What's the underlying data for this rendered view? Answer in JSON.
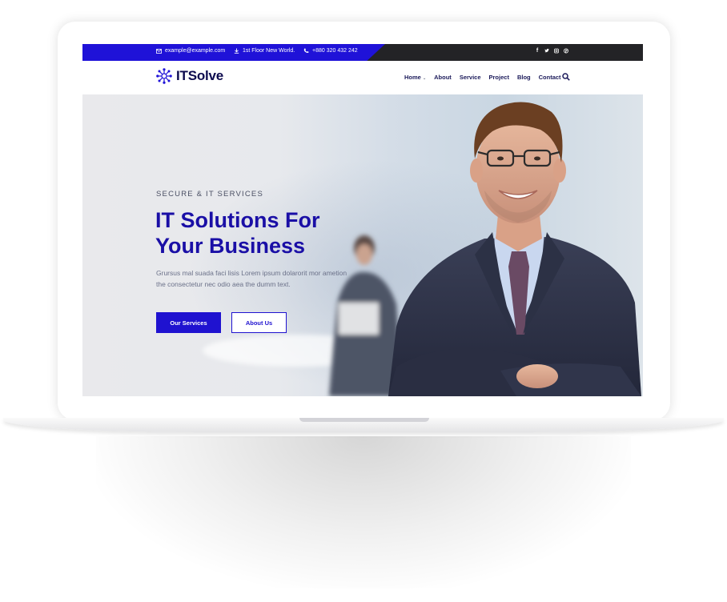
{
  "topbar": {
    "email": "example@example.com",
    "address": "1st Floor New World.",
    "phone": "+880 320 432 242",
    "socials": [
      "facebook-icon",
      "twitter-icon",
      "instagram-icon",
      "pinterest-icon"
    ]
  },
  "header": {
    "logo_text": "ITSolve",
    "nav": [
      {
        "label": "Home",
        "dropdown": true
      },
      {
        "label": "About"
      },
      {
        "label": "Service"
      },
      {
        "label": "Project"
      },
      {
        "label": "Blog"
      },
      {
        "label": "Contact"
      }
    ],
    "search_icon": "search-icon"
  },
  "hero": {
    "subtitle": "SECURE & IT SERVICES",
    "title_line1": "IT Solutions For",
    "title_line2": "Your Business",
    "text_line1": "Grursus mal suada faci lisis Lorem ipsum dolarorit mor ametion",
    "text_line2": "the consectetur nec odio aea the dumm text.",
    "primary_button": "Our Services",
    "secondary_button": "About Us"
  },
  "colors": {
    "brand": "#1f12d8",
    "dark": "#232326",
    "heading": "#1a0fa6",
    "logo": "#0c0a4e"
  }
}
